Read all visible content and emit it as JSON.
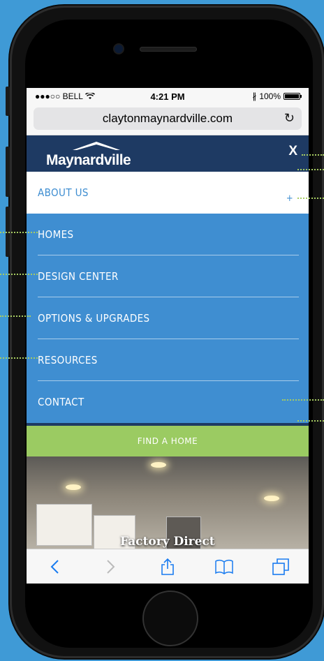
{
  "status_bar": {
    "carrier": "●●●○○ BELL",
    "time": "4:21 PM",
    "battery": "100%"
  },
  "browser": {
    "url": "claytonmaynardville.com"
  },
  "site": {
    "logo_text": "Maynardville",
    "close_label": "X"
  },
  "nav": {
    "items": [
      {
        "label": "ABOUT US",
        "active": true,
        "expand": "+"
      },
      {
        "label": "HOMES"
      },
      {
        "label": "DESIGN CENTER"
      },
      {
        "label": "OPTIONS & UPGRADES"
      },
      {
        "label": "RESOURCES"
      },
      {
        "label": "CONTACT"
      }
    ]
  },
  "cta": {
    "find_home": "FIND A HOME"
  },
  "hero": {
    "caption": "Factory Direct"
  },
  "colors": {
    "header": "#1e3a63",
    "nav": "#3f8ed1",
    "cta": "#9bcb62",
    "callout": "#a7cc62"
  },
  "toolbar": {
    "icons": [
      "back-icon",
      "forward-icon",
      "share-icon",
      "bookmarks-icon",
      "tabs-icon"
    ]
  }
}
